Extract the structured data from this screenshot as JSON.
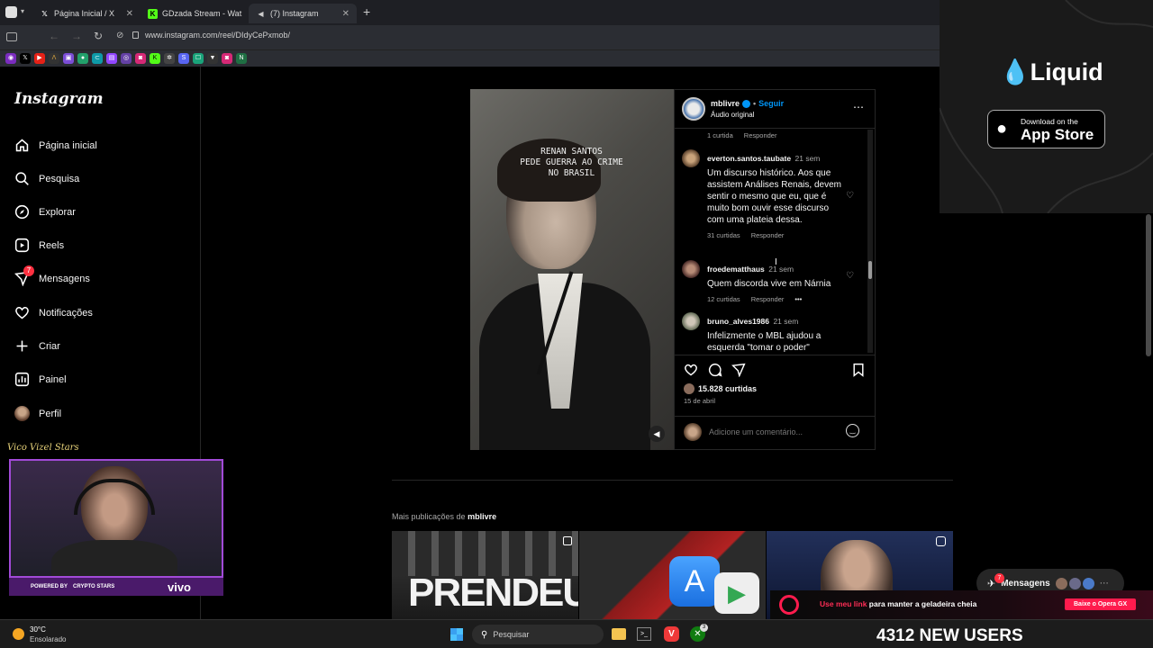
{
  "browser": {
    "tabs": [
      {
        "label": "Página Inicial / X",
        "icon": "x-logo-icon"
      },
      {
        "label": "GDzada Stream - Wat",
        "icon": "kick-logo-icon"
      },
      {
        "label": "(7) Instagram",
        "icon": "speaker-icon"
      }
    ],
    "url": "www.instagram.com/reel/DIdyCePxmob/"
  },
  "ad": {
    "brand": "Liquid",
    "store_small": "Download on the",
    "store_big": "App Store"
  },
  "sidebar": {
    "logo": "Instagram",
    "items": [
      {
        "label": "Página inicial"
      },
      {
        "label": "Pesquisa"
      },
      {
        "label": "Explorar"
      },
      {
        "label": "Reels"
      },
      {
        "label": "Mensagens",
        "badge": "7"
      },
      {
        "label": "Notificações"
      },
      {
        "label": "Criar"
      },
      {
        "label": "Painel"
      },
      {
        "label": "Perfil"
      }
    ]
  },
  "reel": {
    "video_caption": "RENAN SANTOS\nPEDE GUERRA AO CRIME\nNO BRASIL",
    "author": "mblivre",
    "follow": "Seguir",
    "dot": "•",
    "audio": "Áudio original",
    "top_meta_likes": "1 curtida",
    "top_meta_reply": "Responder",
    "comments": [
      {
        "user": "everton.santos.taubate",
        "time": "21 sem",
        "text": "Um discurso histórico. Aos que assistem Análises Renais, devem sentir o mesmo que eu, que é muito bom ouvir esse discurso com uma plateia dessa.",
        "likes": "31 curtidas",
        "reply": "Responder"
      },
      {
        "user": "froedematthaus",
        "time": "21 sem",
        "text": "Quem discorda vive em Nárnia",
        "likes": "12 curtidas",
        "reply": "Responder",
        "more": "•••"
      },
      {
        "user": "bruno_alves1986",
        "time": "21 sem",
        "text": "Infelizmente o MBL ajudou a esquerda \"tomar o poder\" novamente. Mas uma coisa eu",
        "likes": "",
        "reply": ""
      }
    ],
    "likes_total": "15.828 curtidas",
    "date": "15 de abril",
    "comment_placeholder": "Adicione um comentário..."
  },
  "more_posts": {
    "prefix": "Mais publicações de",
    "author": "mblivre",
    "thumb1_text": "PRENDEU"
  },
  "messages_pill": {
    "label": "Mensagens",
    "badge": "7"
  },
  "stream": {
    "brand_top": "Vico Vizel Stars",
    "powered": "POWERED BY",
    "partner": "CRYPTO STARS",
    "vivo": "vivo",
    "banner_text_highlight": "Use meu link",
    "banner_text": " para manter a geladeira cheia",
    "banner_cta": "Baixe o Opera GX",
    "new_users": "4312 NEW USERS"
  },
  "taskbar": {
    "temp": "30°C",
    "weather": "Ensolarado",
    "search": "Pesquisar",
    "badge": "3"
  }
}
